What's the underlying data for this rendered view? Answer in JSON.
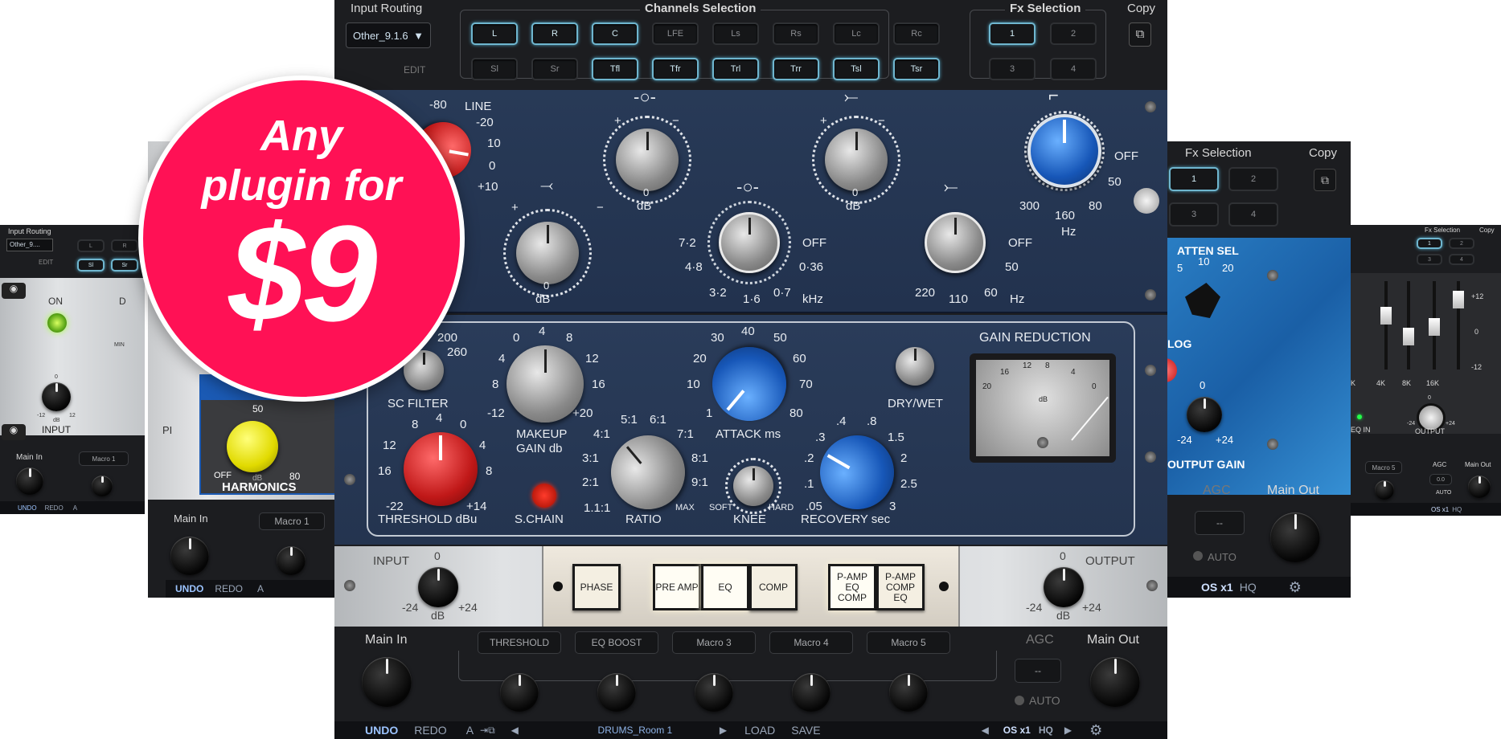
{
  "badge": {
    "line1": "Any",
    "line2": "plugin for",
    "price": "$9",
    "color": "#ff1155"
  },
  "top": {
    "input_routing": "Input Routing",
    "routing_value": "Other_9.1.6",
    "edit": "EDIT",
    "channels_title": "Channels Selection",
    "channels": [
      {
        "label": "L",
        "on": true
      },
      {
        "label": "R",
        "on": true
      },
      {
        "label": "C",
        "on": true
      },
      {
        "label": "LFE",
        "on": false
      },
      {
        "label": "Ls",
        "on": false
      },
      {
        "label": "Rs",
        "on": false
      },
      {
        "label": "Lc",
        "on": false
      },
      {
        "label": "Rc",
        "on": false
      },
      {
        "label": "Sl",
        "on": false
      },
      {
        "label": "Sr",
        "on": false
      },
      {
        "label": "Tfl",
        "on": true
      },
      {
        "label": "Tfr",
        "on": true
      },
      {
        "label": "Trl",
        "on": true
      },
      {
        "label": "Trr",
        "on": true
      },
      {
        "label": "Tsl",
        "on": true
      },
      {
        "label": "Tsr",
        "on": true
      }
    ],
    "fx_title": "Fx Selection",
    "fx": [
      {
        "label": "1",
        "on": true
      },
      {
        "label": "2",
        "on": false
      },
      {
        "label": "3",
        "on": false
      },
      {
        "label": "4",
        "on": false
      }
    ],
    "copy": "Copy"
  },
  "eq": {
    "line": "LINE",
    "neg80": "-80",
    "neg20": "-20",
    "p10": "10",
    "zero": "0",
    "p10b": "+10",
    "db": "dB",
    "plus": "+",
    "minus": "−",
    "off": "OFF",
    "mid_freqs": [
      "7·2",
      "4·8",
      "3·2",
      "1·6",
      "0·7",
      "0·36"
    ],
    "khz": "kHz",
    "low_freqs": [
      "220",
      "110",
      "60",
      "50"
    ],
    "hz": "Hz",
    "hp_freqs": [
      "300",
      "160",
      "80",
      "50"
    ]
  },
  "comp": {
    "sc_filter": "SC FILTER",
    "sc_vals": [
      "200",
      "260"
    ],
    "makeup": "MAKEUP",
    "gain_db": "GAIN db",
    "makeup_vals": [
      "0",
      "4",
      "8",
      "12",
      "16",
      "+20",
      "8",
      "-12"
    ],
    "attack": "ATTACK ms",
    "attack_vals": [
      "30",
      "40",
      "50",
      "20",
      "60",
      "10",
      "70",
      "1",
      "80"
    ],
    "drywet": "DRY/WET",
    "gain_reduction": "GAIN REDUCTION",
    "meter_vals": [
      "20",
      "16",
      "12",
      "8",
      "4",
      "0"
    ],
    "meter_db": "dB",
    "threshold": "THRESHOLD dBu",
    "thr_vals": [
      "8",
      "4",
      "0",
      "12",
      "4",
      "16",
      "8",
      "-22",
      "+14"
    ],
    "schain": "S.CHAIN",
    "ratio": "RATIO",
    "ratio_vals": [
      "5:1",
      "6:1",
      "4:1",
      "7:1",
      "3:1",
      "8:1",
      "2:1",
      "9:1",
      "1.1:1",
      "MAX"
    ],
    "knee": "KNEE",
    "soft": "SOFT",
    "hard": "HARD",
    "recovery": "RECOVERY sec",
    "rec_vals": [
      ".3",
      ".4",
      ".8",
      "1.5",
      ".2",
      "2",
      ".1",
      "2.5",
      ".05",
      "3"
    ]
  },
  "io": {
    "input": "INPUT",
    "output": "OUTPUT",
    "zero": "0",
    "neg24": "-24",
    "p24": "+24",
    "db": "dB",
    "buttons": [
      "PHASE",
      "PRE AMP",
      "EQ",
      "COMP",
      "P-AMP EQ COMP",
      "P-AMP COMP EQ"
    ]
  },
  "bottom": {
    "main_in": "Main In",
    "main_out": "Main Out",
    "agc": "AGC",
    "agc_val": "--",
    "auto": "AUTO",
    "macros": [
      "THRESHOLD",
      "EQ BOOST",
      "Macro 3",
      "Macro 4",
      "Macro 5"
    ],
    "undo": "UNDO",
    "redo": "REDO",
    "a": "A",
    "preset": "DRUMS_Room 1",
    "load": "LOAD",
    "save": "SAVE",
    "os": "OS x1",
    "hq": "HQ"
  },
  "left_far": {
    "input_routing": "Input Routing",
    "routing_value": "Other_9....",
    "edit": "EDIT",
    "on": "ON",
    "d": "D",
    "min": "MIN",
    "zero": "0",
    "neg12": "-12",
    "p12": "12",
    "db": "dB",
    "input": "INPUT",
    "main_in": "Main In",
    "macro1": "Macro 1",
    "undo": "UNDO",
    "redo": "REDO",
    "a": "A",
    "ch": [
      "L",
      "R",
      "Sl",
      "Sr"
    ]
  },
  "left_mid": {
    "harmonics": "HARMONICS",
    "off": "OFF",
    "db": "dB",
    "v50": "50",
    "v80": "80",
    "main_in": "Main In",
    "macro1": "Macro 1",
    "undo": "UNDO",
    "redo": "REDO",
    "a": "A",
    "pi": "PI"
  },
  "right_mid": {
    "fx_title": "Fx Selection",
    "copy": "Copy",
    "fx": [
      "1",
      "2",
      "3",
      "4"
    ],
    "atten": "ATTEN SEL",
    "atten_vals": [
      "5",
      "10",
      "20"
    ],
    "log": "LOG",
    "zero": "0",
    "neg24": "-24",
    "p24": "+24",
    "output_gain": "OUTPUT GAIN",
    "agc": "AGC",
    "agc_val": "--",
    "auto": "AUTO",
    "main_out": "Main Out",
    "os": "OS x1",
    "hq": "HQ"
  },
  "right_far": {
    "fx_title": "Fx Selection",
    "copy": "Copy",
    "scale": [
      "+12",
      "0",
      "-12"
    ],
    "freqs": [
      "K",
      "4K",
      "8K",
      "16K"
    ],
    "eq_in": "EQ IN",
    "output": "OUTPUT",
    "zero": "0",
    "neg24": "-24",
    "p24": "+24",
    "db": "dB",
    "macro5": "Macro 5",
    "agc": "AGC",
    "main_out": "Main Out",
    "agc_val": "0.0",
    "auto": "AUTO",
    "os": "OS x1",
    "hq": "HQ"
  }
}
